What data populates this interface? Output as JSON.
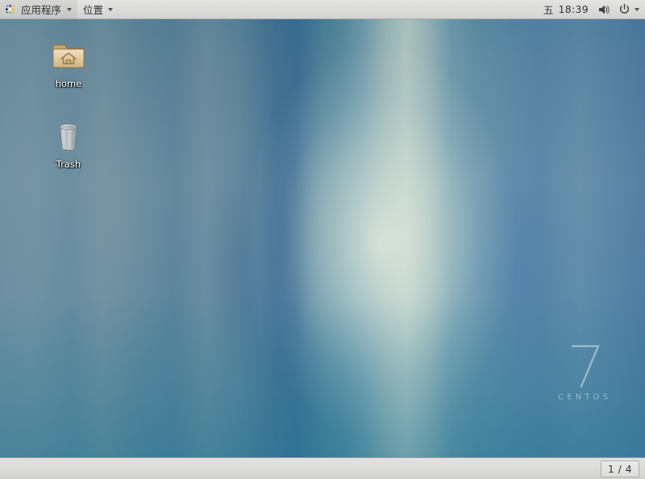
{
  "desktop_environment": {
    "os_name": "CentOS",
    "os_version": "7"
  },
  "top_panel": {
    "applications_menu": {
      "label": "应用程序",
      "icon": "centos-logo-icon",
      "caret": "chevron-down-icon"
    },
    "places_menu": {
      "label": "位置",
      "caret": "chevron-down-icon"
    },
    "clock": {
      "day": "五",
      "time": "18:39"
    },
    "tray": {
      "volume_icon": "volume-speaker-icon",
      "power_icon": "power-icon",
      "menu_caret": "chevron-down-icon"
    }
  },
  "desktop": {
    "icons": [
      {
        "id": "home",
        "label": "home",
        "icon": "home-folder-icon"
      },
      {
        "id": "trash",
        "label": "Trash",
        "icon": "trash-can-icon"
      }
    ],
    "branding": {
      "numeral": "7",
      "wordmark": "CENTOS"
    }
  },
  "bottom_panel": {
    "workspace_switcher": {
      "label": "1 / 4",
      "current": 1,
      "total": 4
    }
  },
  "colors": {
    "panel_background": "#dcdcda",
    "panel_text": "#2e3436",
    "desktop_label_text": "#ffffff",
    "wallpaper_base": "#6b8fa6",
    "wallpaper_highlight": "#e1e9d7",
    "brand_mark": "#ffffff"
  }
}
